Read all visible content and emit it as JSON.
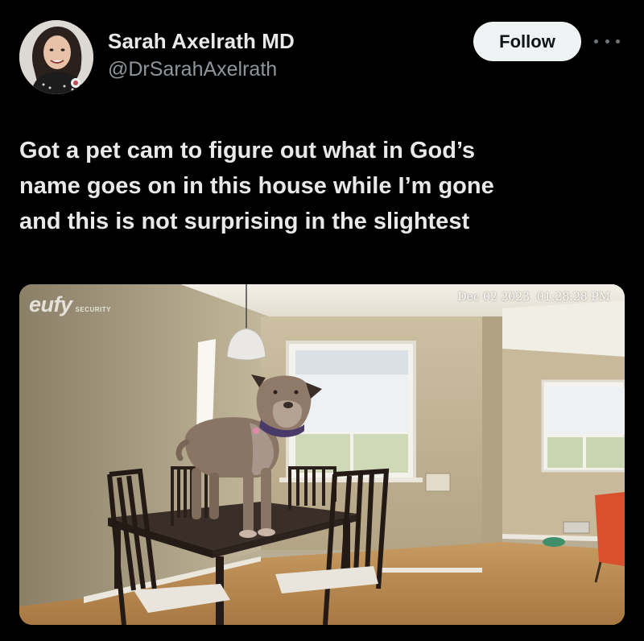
{
  "author": {
    "display_name": "Sarah Axelrath MD",
    "handle": "@DrSarahAxelrath",
    "avatar_icon": "profile-photo"
  },
  "actions": {
    "follow_label": "Follow",
    "more_icon": "more-horizontal-icon"
  },
  "tweet": {
    "text_lines": [
      "Got a pet cam to figure out what in God’s",
      "name goes on in this house while I’m gone",
      "and this is not surprising in the slightest"
    ]
  },
  "media": {
    "timestamp": "Dec 02 2023  01:28:28 PM",
    "brand_logo": "eufy",
    "brand_sub": "SECURITY"
  },
  "colors": {
    "background": "#000000",
    "primary_text": "#e7e9ea",
    "secondary_text": "#8f959a",
    "follow_button_bg": "#eff3f4",
    "follow_button_text": "#0f1419"
  }
}
